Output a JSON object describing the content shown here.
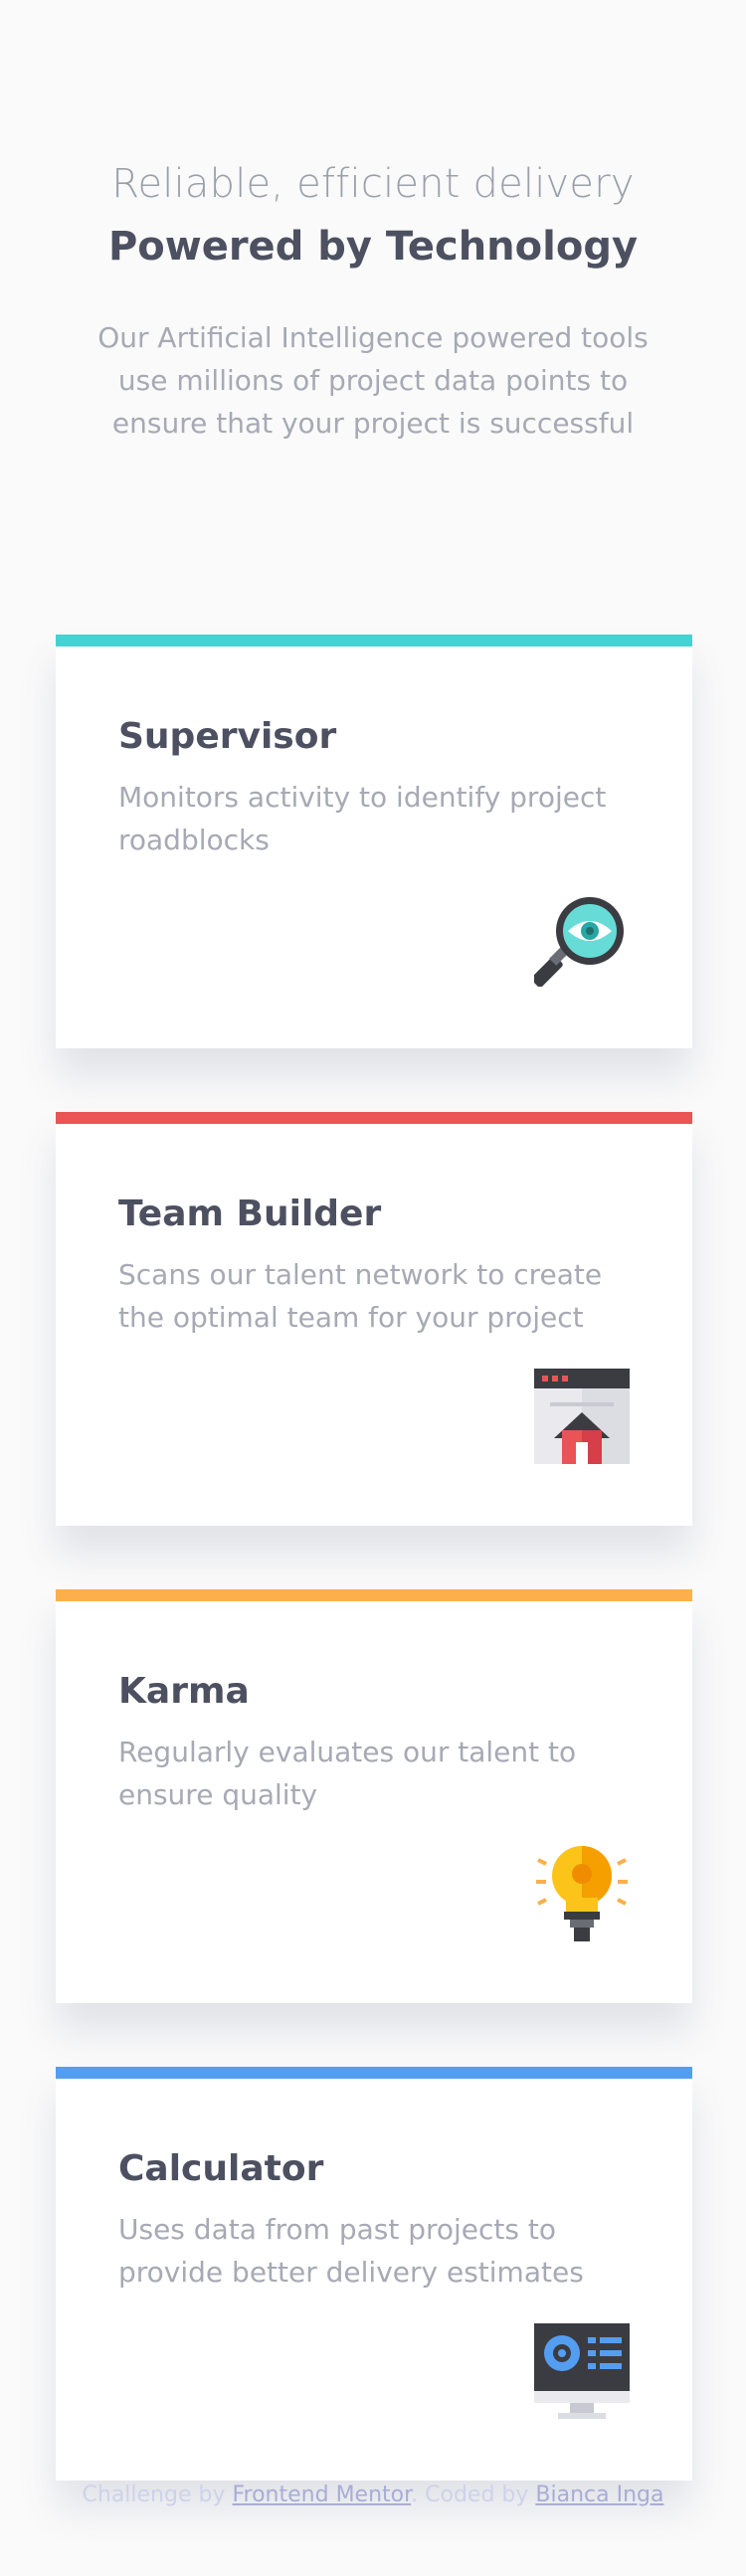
{
  "header": {
    "subtitle": "Reliable, efficient delivery",
    "title": "Powered by Technology",
    "intro": "Our Artificial Intelligence powered tools use millions of project data points to ensure that your project is successful"
  },
  "cards": [
    {
      "title": "Supervisor",
      "description": "Monitors activity to identify project roadblocks",
      "icon": "magnifier-eye-icon",
      "accent": "#44d3d2"
    },
    {
      "title": "Team Builder",
      "description": "Scans our talent network to create the optimal team for your project",
      "icon": "browser-house-icon",
      "accent": "#ea5454"
    },
    {
      "title": "Karma",
      "description": "Regularly evaluates our talent to ensure quality",
      "icon": "lightbulb-icon",
      "accent": "#fcaf4a"
    },
    {
      "title": "Calculator",
      "description": "Uses data from past projects to provide better delivery estimates",
      "icon": "monitor-calculator-icon",
      "accent": "#549ef2"
    }
  ],
  "attribution": {
    "prefix": "Challenge by ",
    "link1": "Frontend Mentor",
    "middle": ". Coded by ",
    "link2": "Bianca Inga"
  }
}
